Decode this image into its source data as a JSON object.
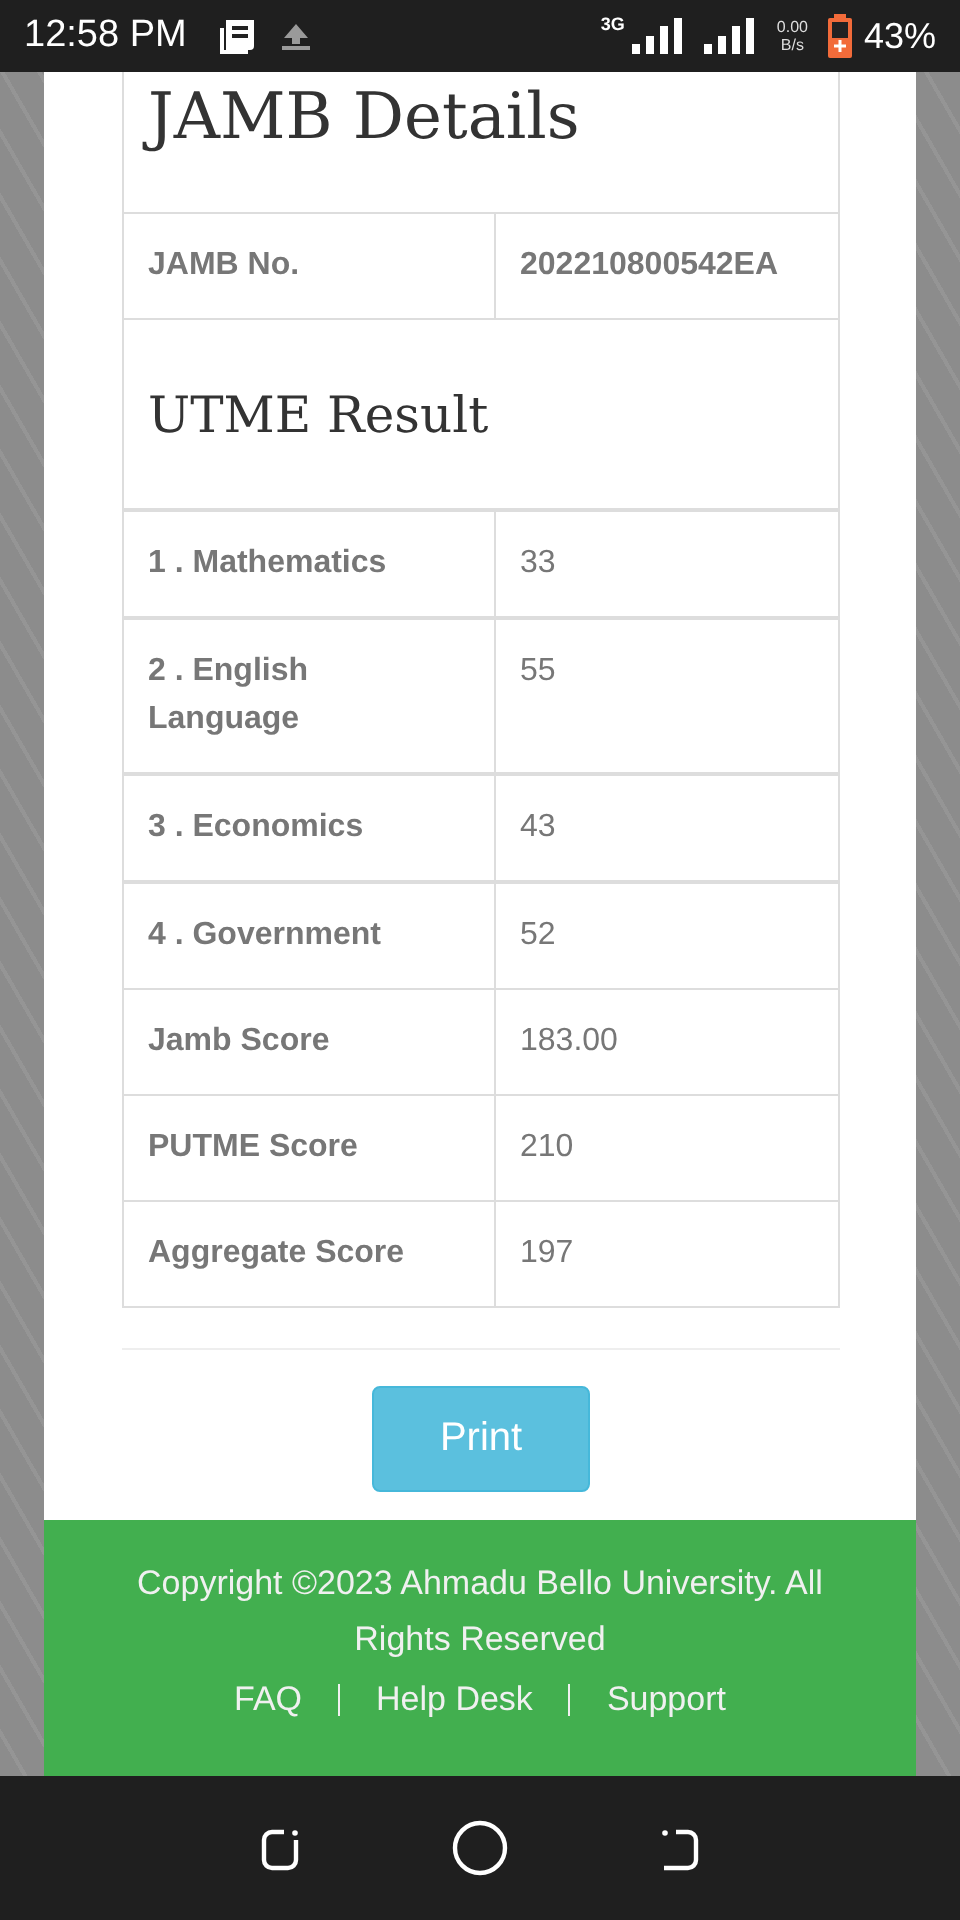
{
  "status_bar": {
    "time": "12:58 PM",
    "network": "3G",
    "speed_value": "0.00",
    "speed_unit": "B/s",
    "battery": "43%"
  },
  "jamb_details": {
    "title": "JAMB Details",
    "rows": [
      {
        "label": "JAMB No.",
        "value": "202210800542EA"
      }
    ]
  },
  "utme_result": {
    "title": "UTME Result",
    "subjects": [
      {
        "label": "1 . Mathematics",
        "value": "33"
      },
      {
        "label": "2 . English Language",
        "value": "55"
      },
      {
        "label": "3 . Economics",
        "value": "43"
      },
      {
        "label": "4 . Government",
        "value": "52"
      }
    ],
    "scores": [
      {
        "label": "Jamb Score",
        "value": "183.00"
      },
      {
        "label": "PUTME Score",
        "value": "210"
      },
      {
        "label": "Aggregate Score",
        "value": "197"
      }
    ]
  },
  "print_button": "Print",
  "footer": {
    "copyright": "Copyright ©2023 Ahmadu Bello University. All Rights Reserved",
    "links": [
      "FAQ",
      "Help Desk",
      "Support"
    ]
  }
}
